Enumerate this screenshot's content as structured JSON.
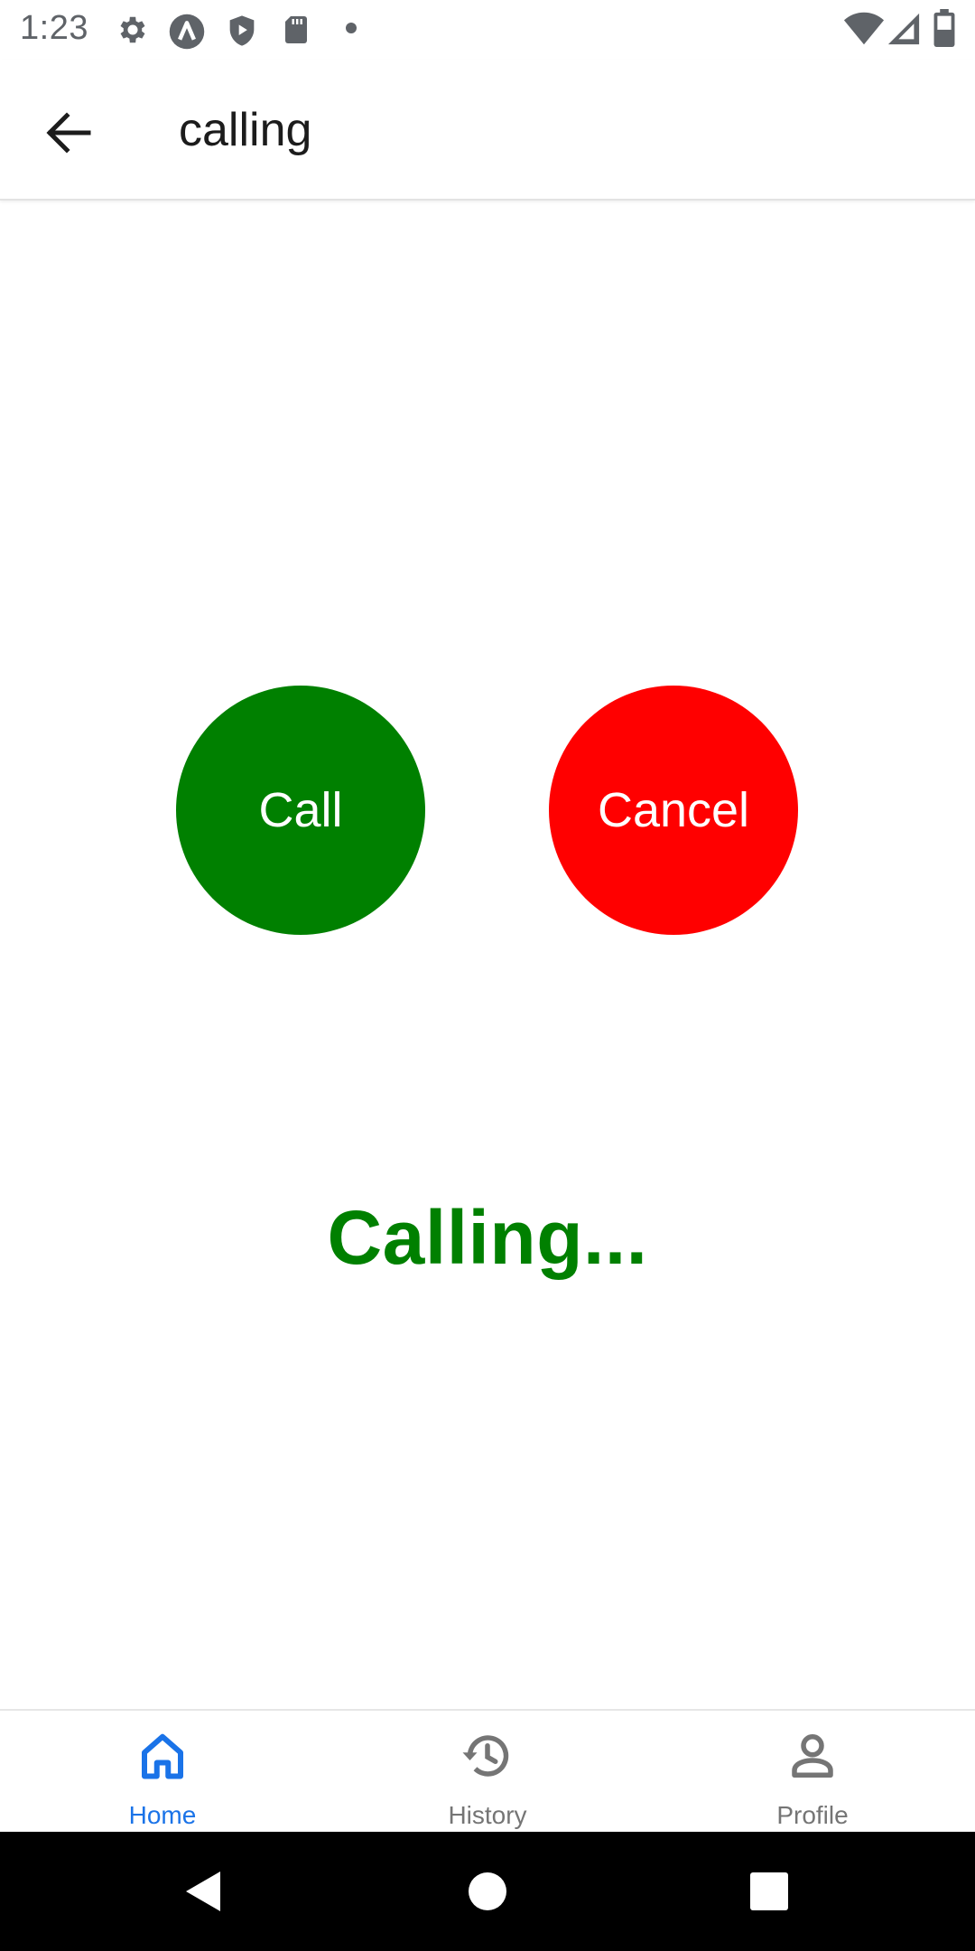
{
  "status_bar": {
    "time": "1:23",
    "icons_left": [
      "gear-icon",
      "android-icon",
      "shield-play-icon",
      "sd-card-icon",
      "dot-icon"
    ],
    "icons_right": [
      "wifi-icon",
      "signal-icon",
      "battery-icon"
    ]
  },
  "app_bar": {
    "title": "calling",
    "back_icon": "arrow-left-icon"
  },
  "main": {
    "call_label": "Call",
    "cancel_label": "Cancel",
    "status_text": "Calling..."
  },
  "bottom_nav": {
    "items": [
      {
        "label": "Home",
        "icon": "home-icon",
        "active": true
      },
      {
        "label": "History",
        "icon": "history-icon",
        "active": false
      },
      {
        "label": "Profile",
        "icon": "person-icon",
        "active": false
      }
    ]
  },
  "system_nav": {
    "icons": [
      "back-triangle-icon",
      "home-circle-icon",
      "recents-square-icon"
    ]
  },
  "colors": {
    "call_green": "#008000",
    "cancel_red": "#ff0000",
    "status_green": "#008000",
    "nav_active": "#1a73e8",
    "nav_inactive": "#757575",
    "system_bar": "#000000"
  }
}
